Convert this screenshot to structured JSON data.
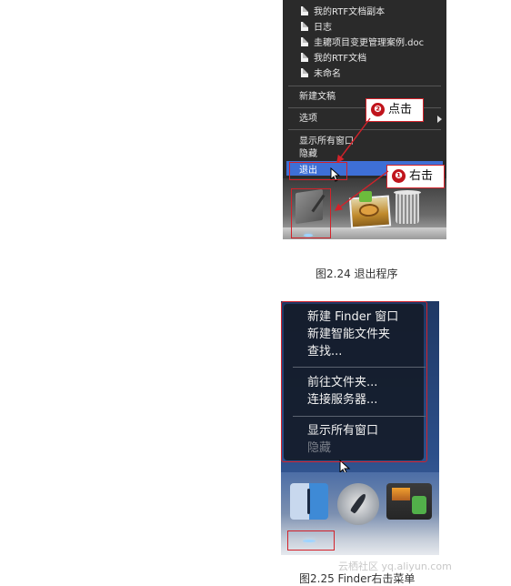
{
  "figure1": {
    "recent_docs": [
      "我的RTF文档副本",
      "日志",
      "圭耱项目变更管理案例.doc",
      "我的RTF文档",
      "未命名"
    ],
    "menu": {
      "new_document": "新建文稿",
      "options": "选项",
      "show_all_windows": "显示所有窗口",
      "hide": "隐藏",
      "quit": "退出"
    },
    "callouts": {
      "step1_num": "❶",
      "step1_label": "右击",
      "step2_num": "❷",
      "step2_label": "点击"
    },
    "caption": "图2.24    退出程序"
  },
  "figure2": {
    "menu": {
      "new_finder_window": "新建 Finder 窗口",
      "new_smart_folder": "新建智能文件夹",
      "find": "查找...",
      "go_to_folder": "前往文件夹...",
      "connect_to_server": "连接服务器...",
      "show_all_windows": "显示所有窗口",
      "hide": "隐藏"
    },
    "caption": "图2.25    Finder右击菜单"
  },
  "watermark": "云栖社区 yq.aliyun.com",
  "colors": {
    "highlight_red": "#d3222a",
    "selection_blue": "#3e6fd6"
  },
  "icons": [
    "document-icon",
    "notepad-app-icon",
    "photo-app-icon",
    "trash-icon",
    "finder-icon",
    "launchpad-rocket-icon",
    "gallery-app-icon",
    "mouse-cursor-icon"
  ]
}
